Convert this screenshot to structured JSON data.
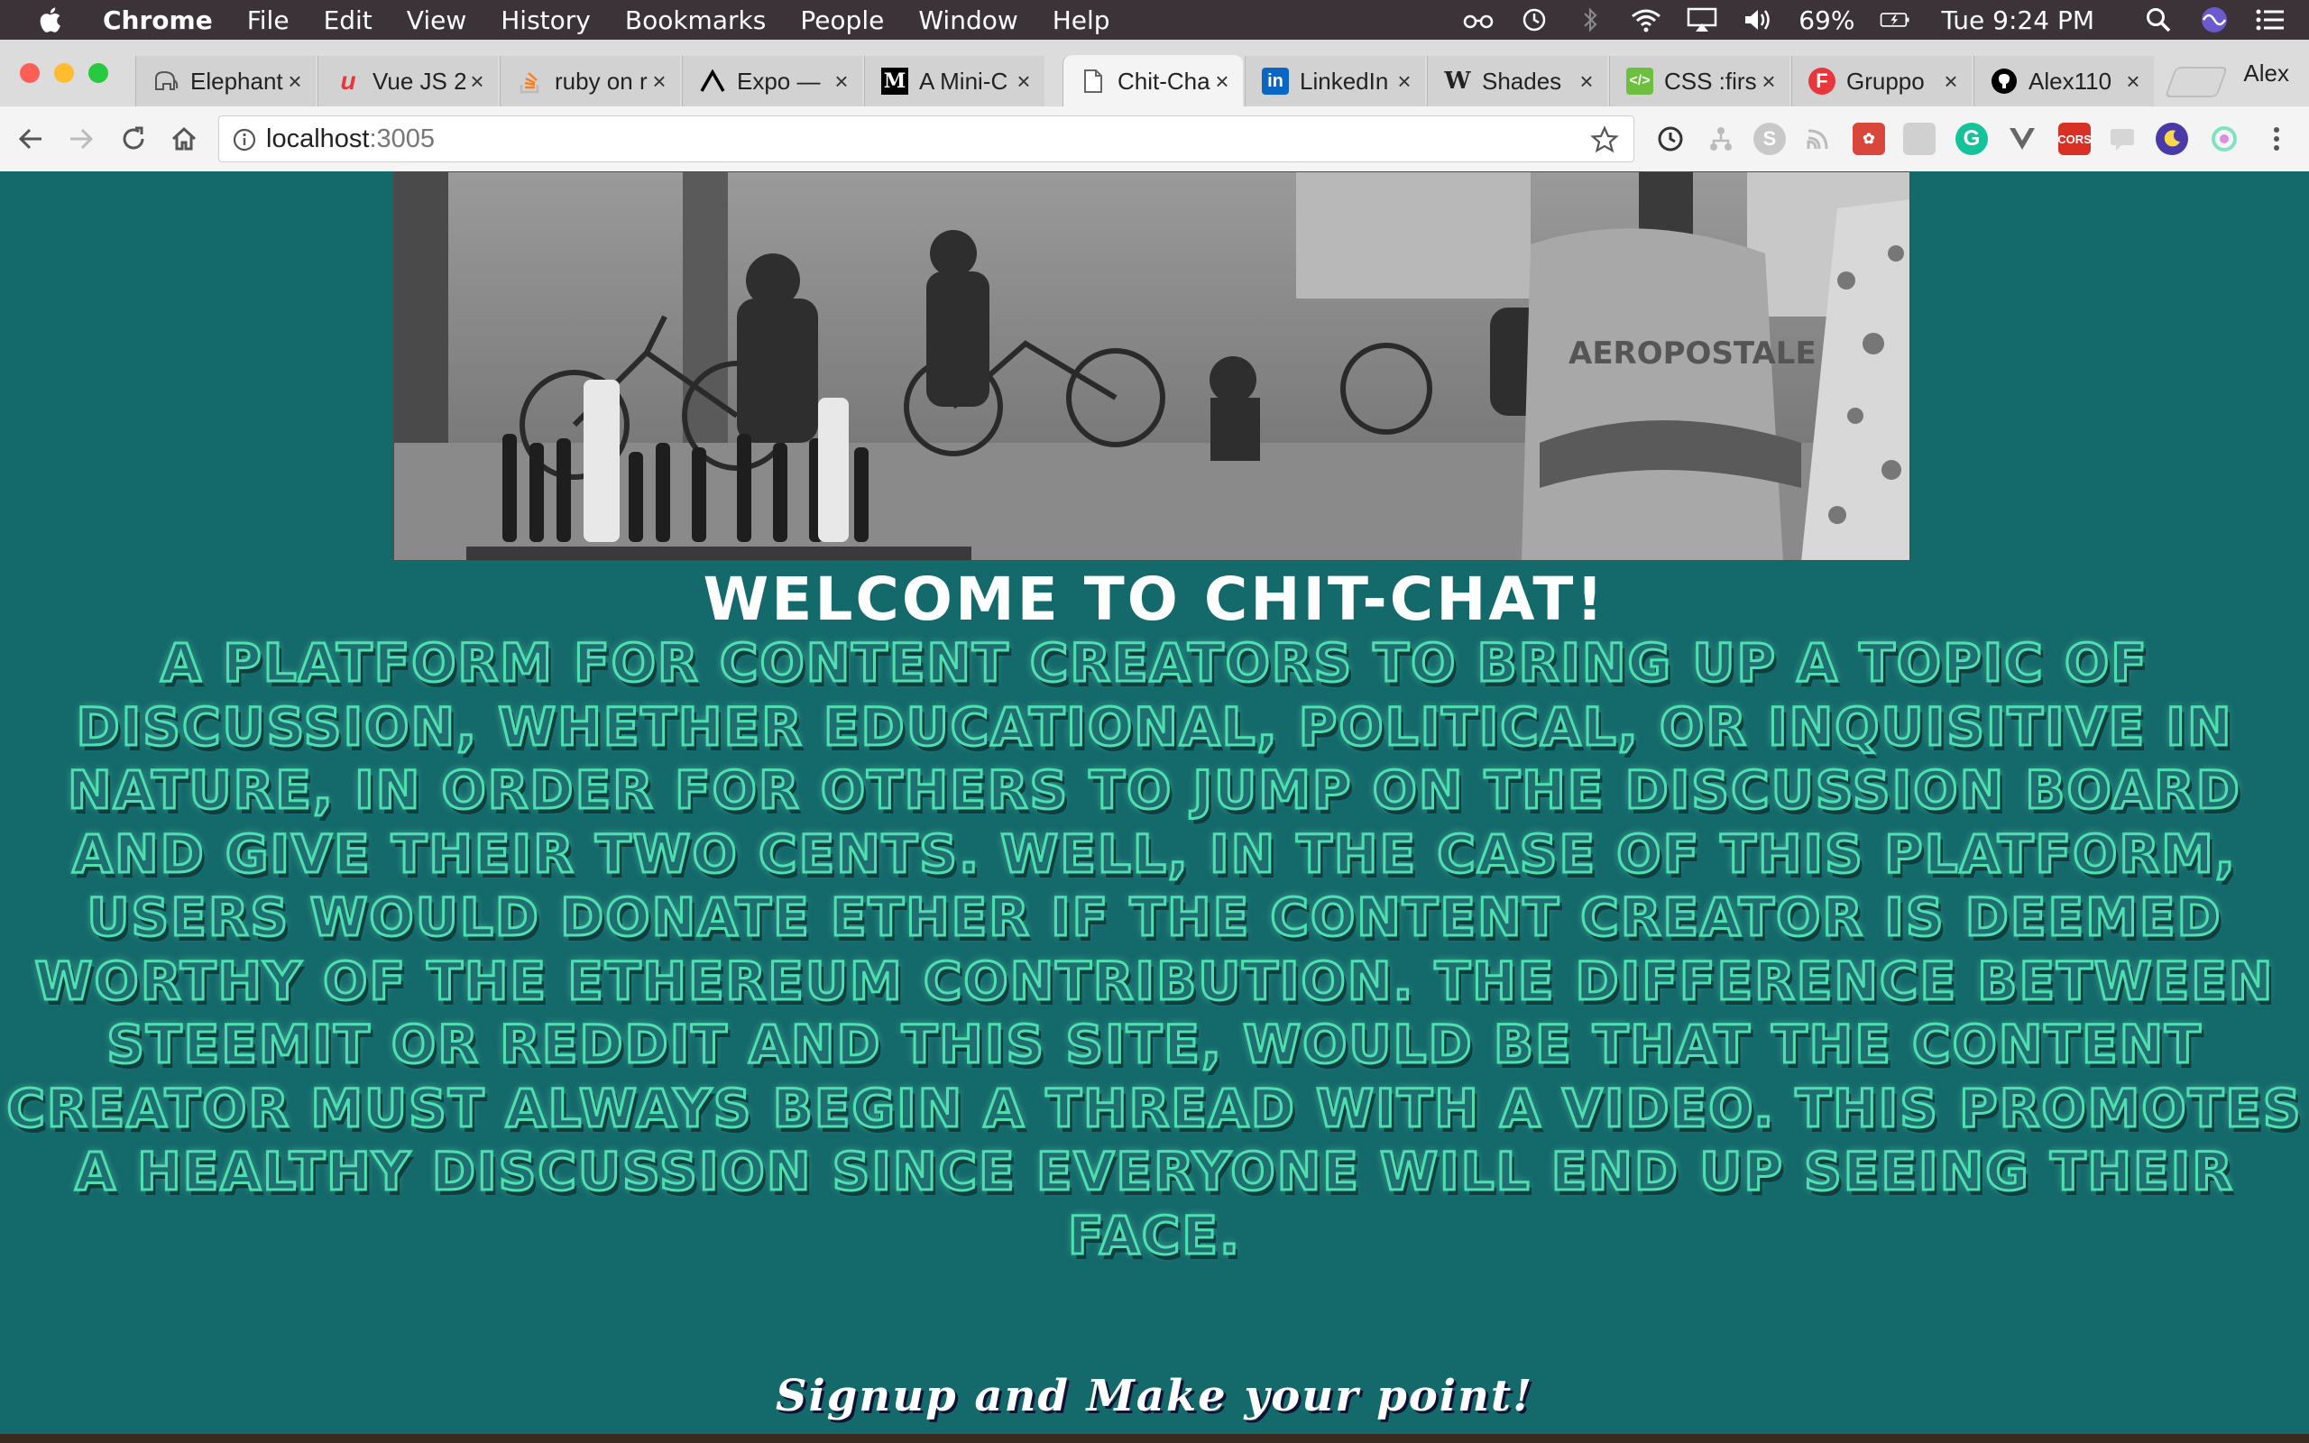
{
  "menubar": {
    "app_name": "Chrome",
    "items": [
      "File",
      "Edit",
      "View",
      "History",
      "Bookmarks",
      "People",
      "Window",
      "Help"
    ],
    "battery": "69%",
    "clock": "Tue 9:24 PM"
  },
  "tabs": [
    {
      "title": "Elephant",
      "favicon": "elephant-icon",
      "color": "#555555"
    },
    {
      "title": "Vue JS 2",
      "favicon": "udemy-icon",
      "color": "#e8363d"
    },
    {
      "title": "ruby on r",
      "favicon": "stackoverflow-icon",
      "color": "#f48024"
    },
    {
      "title": "Expo —",
      "favicon": "expo-icon",
      "color": "#000000"
    },
    {
      "title": "A Mini-C",
      "favicon": "medium-icon",
      "color": "#000000"
    },
    {
      "title": "Chit-Cha",
      "favicon": "page-icon",
      "color": "#666666",
      "active": true
    },
    {
      "title": "LinkedIn",
      "favicon": "linkedin-icon",
      "color": "#0a66c2"
    },
    {
      "title": "Shades",
      "favicon": "wikipedia-icon",
      "color": "#000000"
    },
    {
      "title": "CSS :firs",
      "favicon": "css-icon",
      "color": "#6dbf3f"
    },
    {
      "title": "Gruppo",
      "favicon": "f-icon",
      "color": "#e8363d"
    },
    {
      "title": "Alex110",
      "favicon": "github-icon",
      "color": "#000000"
    }
  ],
  "profile_name": "Alex",
  "omnibox": {
    "host": "localhost",
    "port": ":3005"
  },
  "page": {
    "welcome": "Welcome to Chit-Chat!",
    "description": "A platform for content creators to bring up a topic of discussion, whether educational, political, or inquisitive in nature, in order for others to jump on the discussion board and give their two cents. Well, in the case of this platform, users would donate ether if the content creator is deemed worthy of the ethereum contribution. The difference between Steemit or Reddit and this site, would be that the content creator must always begin a thread with a video. This promotes a healthy discussion since everyone will end up seeing their face.",
    "signup": "Signup and Make your point!"
  },
  "colors": {
    "page_bg": "#14696a",
    "description_outline": "#4fe0b0",
    "heading_text": "#ffffff"
  }
}
